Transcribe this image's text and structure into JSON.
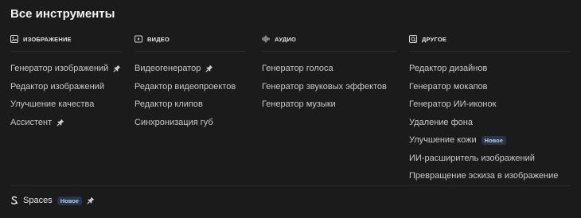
{
  "title": "Все инструменты",
  "columns": [
    {
      "heading": "ИЗОБРАЖЕНИЕ",
      "icon": "image-icon",
      "items": [
        {
          "label": "Генератор изображений",
          "pinned": true
        },
        {
          "label": "Редактор изображений"
        },
        {
          "label": "Улучшение качества"
        },
        {
          "label": "Ассистент",
          "pinned": true
        }
      ]
    },
    {
      "heading": "ВИДЕО",
      "icon": "video-icon",
      "items": [
        {
          "label": "Видеогенератор",
          "pinned": true
        },
        {
          "label": "Редактор видеопроектов"
        },
        {
          "label": "Редактор клипов"
        },
        {
          "label": "Синхронизация губ"
        }
      ]
    },
    {
      "heading": "АУДИО",
      "icon": "audio-wave-icon",
      "items": [
        {
          "label": "Генератор голоса"
        },
        {
          "label": "Генератор звуковых эффектов"
        },
        {
          "label": "Генератор музыки"
        }
      ]
    },
    {
      "heading": "ДРУГОЕ",
      "icon": "other-tools-icon",
      "items": [
        {
          "label": "Редактор дизайнов"
        },
        {
          "label": "Генератор мокапов"
        },
        {
          "label": "Генератор ИИ-иконок"
        },
        {
          "label": "Удаление фона"
        },
        {
          "label": "Улучшение кожи",
          "badge": "Новое"
        },
        {
          "label": "ИИ-расширитель изображений"
        },
        {
          "label": "Превращение эскиза в изображение"
        }
      ]
    }
  ],
  "spaces": {
    "label": "Spaces",
    "badge": "Новое",
    "pinned": true,
    "icon": "spaces-icon"
  }
}
